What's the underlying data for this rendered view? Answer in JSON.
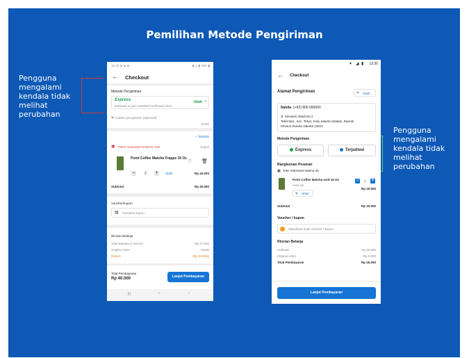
{
  "slide": {
    "title": "Pemilihan Metode Pengiriman",
    "annotation_left": "Pengguna mengalami kendala tidak melihat perubahan",
    "annotation_right": "Pengguna mengalami kendala tidak melihat perubahan"
  },
  "phone_a": {
    "status_left": "18.20 ⊕ ⊕ ⊕ ·",
    "status_right": "▮ ⊿ ▮ 45% ▮",
    "header_title": "Checkout",
    "shipping_label": "Metode Pengiriman",
    "express_name": "Express",
    "express_desc": "Estimasi ±1 jam (setelah konfirmasi toko)",
    "express_change": "Ubah",
    "note_placeholder": "Catatan pengiriman (opsional)",
    "note_count": "0/200",
    "add_link": "+ Tambah",
    "store_name": "TOKO indomaret HAMAR JUD",
    "store_action": "Hapus",
    "product_name": "Point Coffee Matcha Frappe 16 Oz",
    "qty": "2",
    "edit_label": "Ubah",
    "product_price": "Rp 40.000",
    "subtotal_label": "Subtotal",
    "subtotal_value": "Rp 40.000",
    "voucher_label": "Voucher/Kupon",
    "voucher_placeholder": "Gunakan kupon",
    "summary_title": "Rincian Belanja",
    "summary_rows": [
      {
        "label": "Total Belanja (1 item/s)",
        "value": "Rp 47.000"
      },
      {
        "label": "Ongkos Kirim",
        "value": "Gratis"
      },
      {
        "label": "Diskon",
        "value": "(Rp 20.000)"
      }
    ],
    "total_label": "Total Pembayaran",
    "total_value": "Rp 40.000",
    "pay_button": "Lanjut Pembayaran",
    "nav_icons": [
      "|||",
      "○",
      "‹"
    ]
  },
  "phone_b": {
    "status_time": "12:30",
    "header_title": "Checkout",
    "address_title": "Alamat Pengiriman",
    "address_edit": "Ubah",
    "recipient_name": "Nabila",
    "recipient_phone": "(+62) 800 000000",
    "address_line1": "Jl. Semanis Abadi No.2",
    "address_line2": "Tebet Bar., Kec. Tebet, Kota Jakarta Selatan, Daerah",
    "address_line3": "Khusus Ibukota Jakarta 12810",
    "shipping_title": "Metode Pengiriman",
    "option_express": "Express",
    "option_scheduled": "Terjadwal",
    "order_title": "Rangkuman Pesanan",
    "store_name": "Toko Indomaret Warna 46",
    "product_name": "Point Coffee Matcha Iced 16 Oz",
    "product_variant": "Less ice",
    "qty": "1",
    "edit_label": "Ubah",
    "product_price": "Rp 20.000",
    "subtotal_label": "Subtotal",
    "subtotal_value": "Rp 20.000",
    "voucher_title": "Voucher / kupon",
    "voucher_placeholder": "Masukkan kode voucher / kupon",
    "summary_title": "Rincian Belanja",
    "summary_rows": [
      {
        "label": "Subtotal",
        "value": "Rp 20.000"
      },
      {
        "label": "Ongkos Kirim",
        "value": "Rp 5.000"
      },
      {
        "label": "Total Pembayaran",
        "value": "Rp 25.000"
      }
    ],
    "pay_button": "Lanjut Pembayaran"
  },
  "colors": {
    "slide_bg": "#0d59b5",
    "primary": "#1574d4",
    "discount": "#e67e22",
    "express_green": "#1e9f4c",
    "bracket_red": "#d83a3a",
    "bracket_green": "#6fcf6f"
  }
}
